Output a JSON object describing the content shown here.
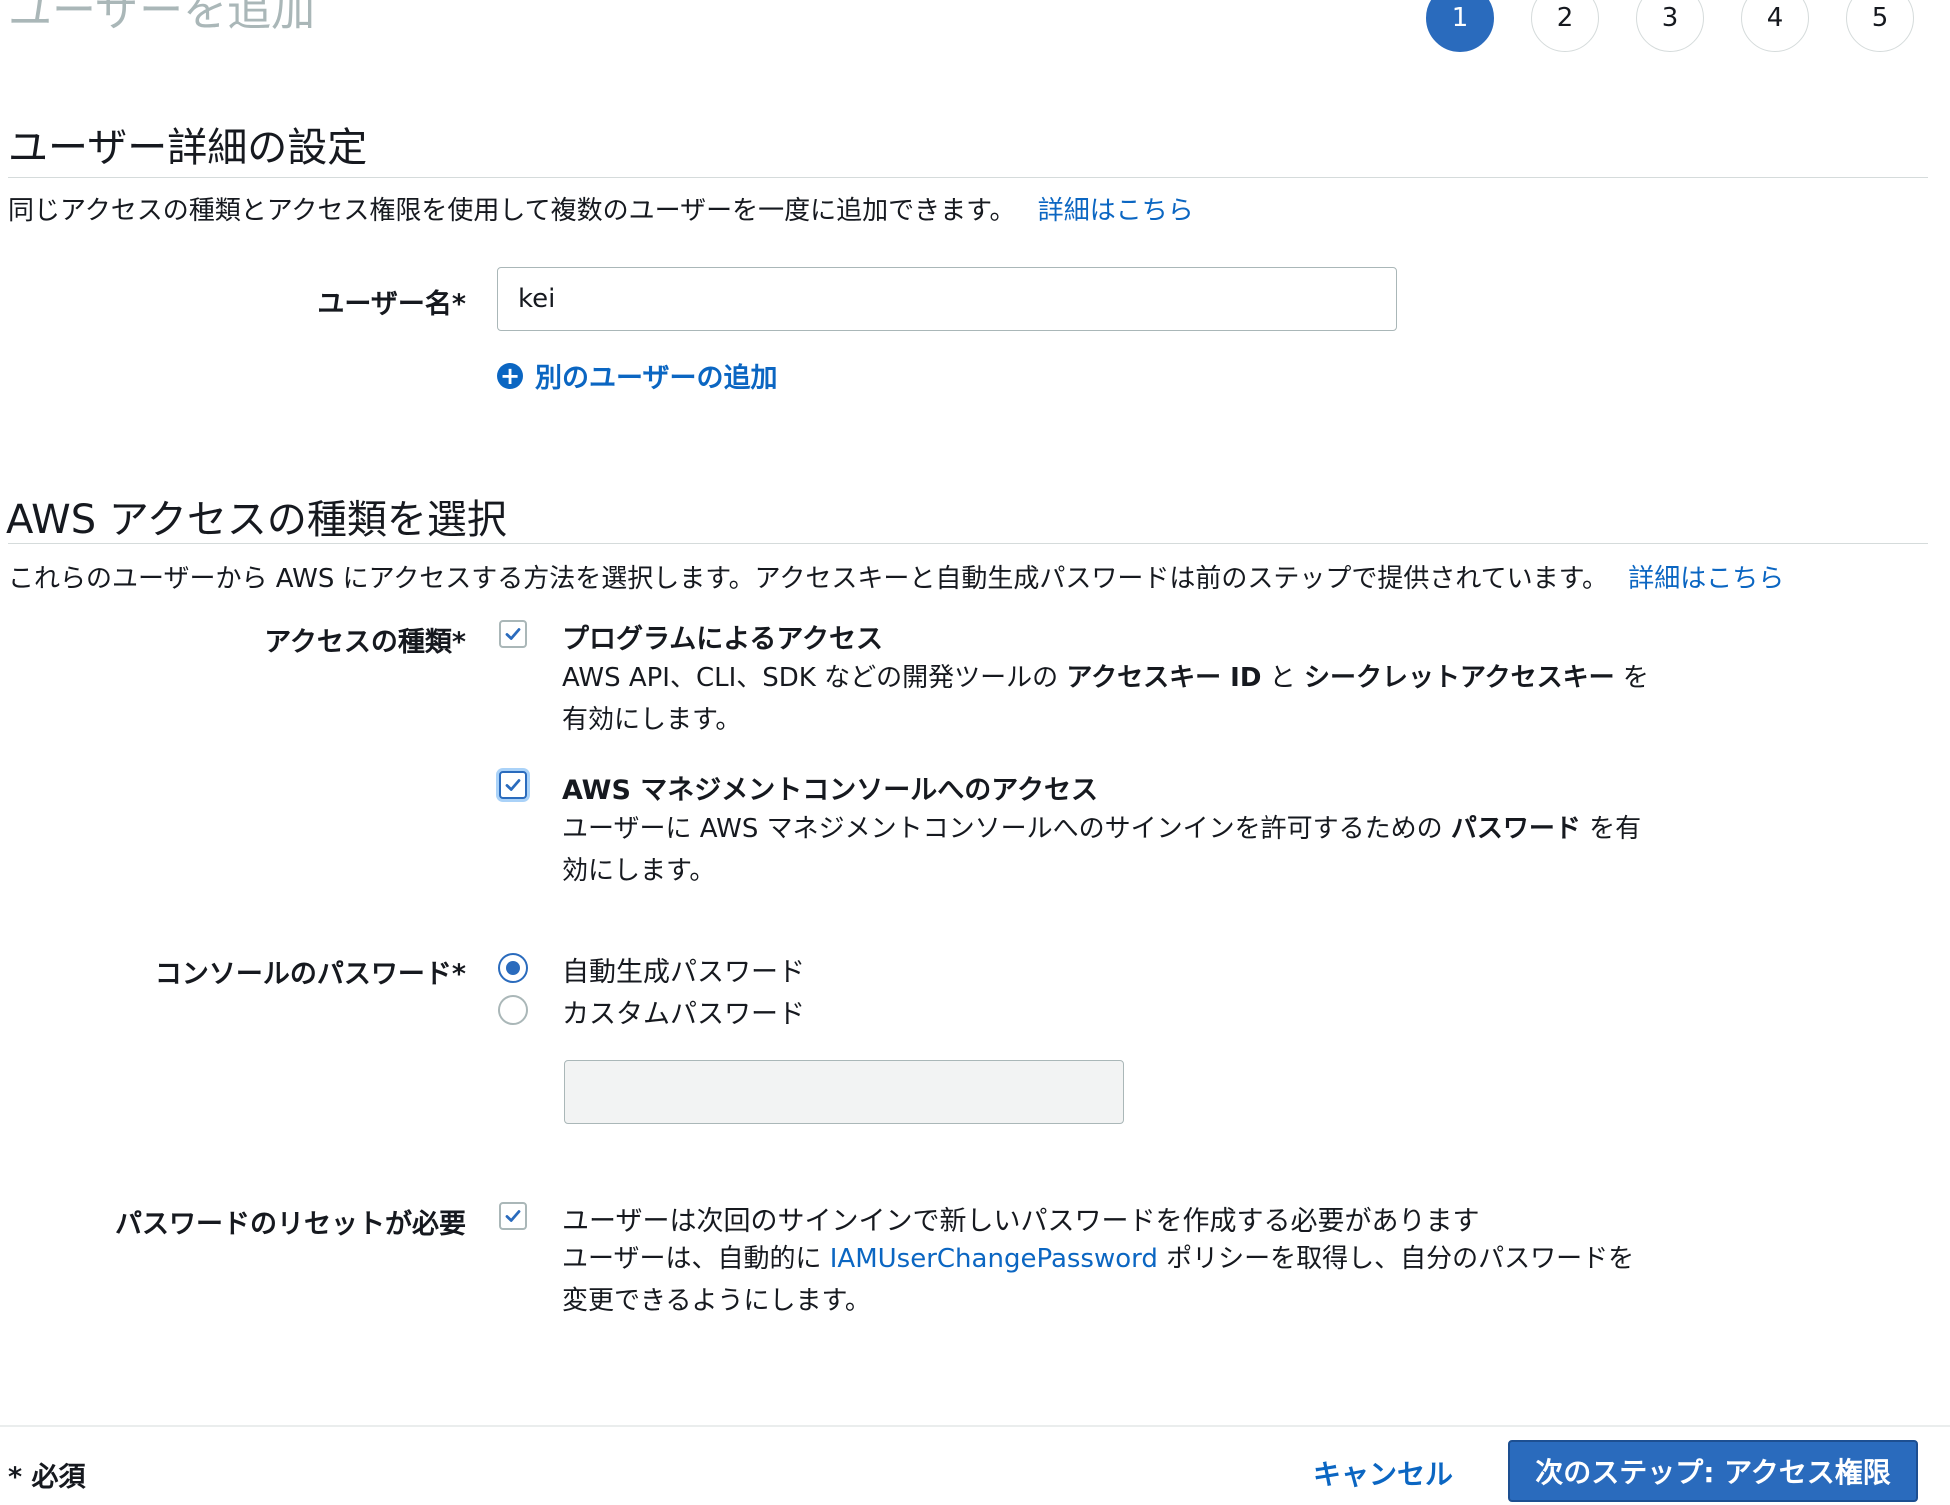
{
  "page": {
    "title": "ユーザーを追加"
  },
  "steps": [
    {
      "label": "1",
      "active": true
    },
    {
      "label": "2",
      "active": false
    },
    {
      "label": "3",
      "active": false
    },
    {
      "label": "4",
      "active": false
    },
    {
      "label": "5",
      "active": false
    }
  ],
  "details": {
    "title": "ユーザー詳細の設定",
    "description": "同じアクセスの種類とアクセス権限を使用して複数のユーザーを一度に追加できます。",
    "learn_more": "詳細はこちら",
    "username_label": "ユーザー名*",
    "username_value": "kei",
    "add_user": "別のユーザーの追加"
  },
  "access": {
    "title": "AWS アクセスの種類を選択",
    "description": "これらのユーザーから AWS にアクセスする方法を選択します。アクセスキーと自動生成パスワードは前のステップで提供されています。",
    "learn_more": "詳細はこちら",
    "type_label": "アクセスの種類*",
    "programmatic": {
      "title": "プログラムによるアクセス",
      "desc_1": "AWS API、CLI、SDK などの開発ツールの ",
      "desc_bold_1": "アクセスキー ID",
      "desc_2": " と ",
      "desc_bold_2": "シークレットアクセスキー",
      "desc_3": " を有効にします。",
      "checked": true
    },
    "console": {
      "title": "AWS マネジメントコンソールへのアクセス",
      "desc_1": "ユーザーに AWS マネジメントコンソールへのサインインを許可するための ",
      "desc_bold": "パスワード",
      "desc_2": " を有効にします。",
      "checked": true
    }
  },
  "password": {
    "label": "コンソールのパスワード*",
    "auto": "自動生成パスワード",
    "custom": "カスタムパスワード",
    "selected": "auto",
    "custom_value": ""
  },
  "reset": {
    "label": "パスワードのリセットが必要",
    "title": "ユーザーは次回のサインインで新しいパスワードを作成する必要があります",
    "desc_1": "ユーザーは、自動的に ",
    "desc_link": "IAMUserChangePassword",
    "desc_2": " ポリシーを取得し、自分のパスワードを変更できるようにします。",
    "checked": true
  },
  "footer": {
    "required_note": "* 必須",
    "cancel": "キャンセル",
    "next": "次のステップ: アクセス権限"
  },
  "colors": {
    "primary": "#2a6bbd",
    "link": "#0b66c2",
    "border": "#aab7b8",
    "divider": "#d5dbdb"
  }
}
